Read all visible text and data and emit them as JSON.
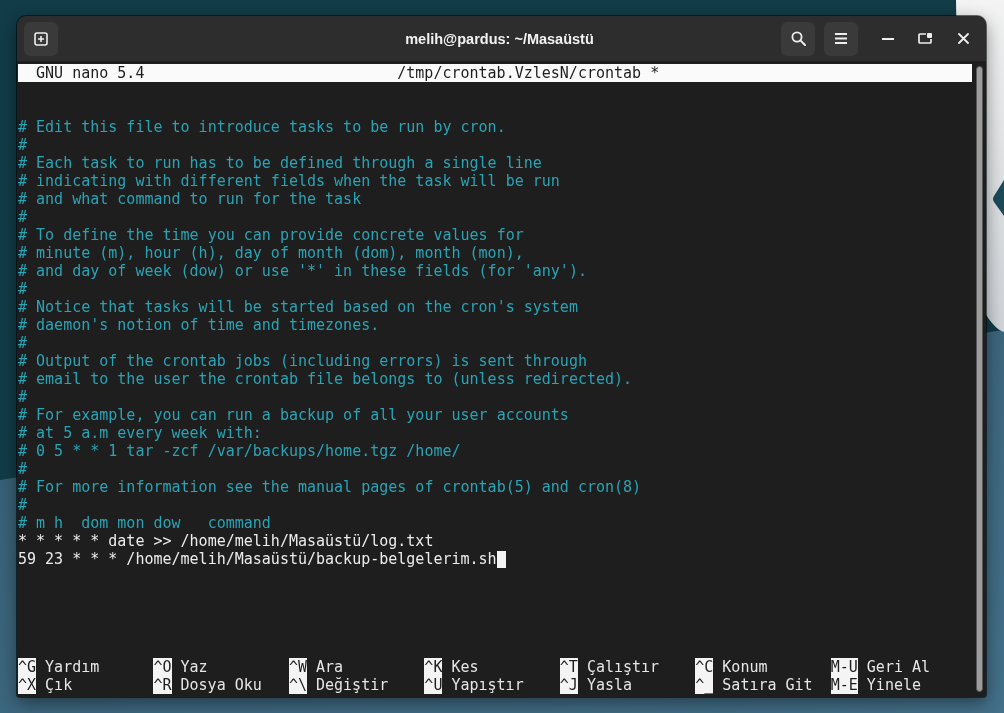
{
  "window": {
    "title": "melih@pardus: ~/Masaüstü"
  },
  "editor": {
    "version": "GNU nano 5.4",
    "file": "/tmp/crontab.VzlesN/crontab *",
    "lines": [
      {
        "kind": "comment",
        "text": "# Edit this file to introduce tasks to be run by cron.",
        "cursor": false
      },
      {
        "kind": "comment",
        "text": "#",
        "cursor": false
      },
      {
        "kind": "comment",
        "text": "# Each task to run has to be defined through a single line",
        "cursor": false
      },
      {
        "kind": "comment",
        "text": "# indicating with different fields when the task will be run",
        "cursor": false
      },
      {
        "kind": "comment",
        "text": "# and what command to run for the task",
        "cursor": false
      },
      {
        "kind": "comment",
        "text": "#",
        "cursor": false
      },
      {
        "kind": "comment",
        "text": "# To define the time you can provide concrete values for",
        "cursor": false
      },
      {
        "kind": "comment",
        "text": "# minute (m), hour (h), day of month (dom), month (mon),",
        "cursor": false
      },
      {
        "kind": "comment",
        "text": "# and day of week (dow) or use '*' in these fields (for 'any').",
        "cursor": false
      },
      {
        "kind": "comment",
        "text": "#",
        "cursor": false
      },
      {
        "kind": "comment",
        "text": "# Notice that tasks will be started based on the cron's system",
        "cursor": false
      },
      {
        "kind": "comment",
        "text": "# daemon's notion of time and timezones.",
        "cursor": false
      },
      {
        "kind": "comment",
        "text": "#",
        "cursor": false
      },
      {
        "kind": "comment",
        "text": "# Output of the crontab jobs (including errors) is sent through",
        "cursor": false
      },
      {
        "kind": "comment",
        "text": "# email to the user the crontab file belongs to (unless redirected).",
        "cursor": false
      },
      {
        "kind": "comment",
        "text": "#",
        "cursor": false
      },
      {
        "kind": "comment",
        "text": "# For example, you can run a backup of all your user accounts",
        "cursor": false
      },
      {
        "kind": "comment",
        "text": "# at 5 a.m every week with:",
        "cursor": false
      },
      {
        "kind": "comment",
        "text": "# 0 5 * * 1 tar -zcf /var/backups/home.tgz /home/",
        "cursor": false
      },
      {
        "kind": "comment",
        "text": "#",
        "cursor": false
      },
      {
        "kind": "comment",
        "text": "# For more information see the manual pages of crontab(5) and cron(8)",
        "cursor": false
      },
      {
        "kind": "comment",
        "text": "#",
        "cursor": false
      },
      {
        "kind": "comment",
        "text": "# m h  dom mon dow   command",
        "cursor": false
      },
      {
        "kind": "entry",
        "text": "* * * * * date >> /home/melih/Masaüstü/log.txt",
        "cursor": false
      },
      {
        "kind": "entry",
        "text": "59 23 * * * /home/melih/Masaüstü/backup-belgelerim.sh",
        "cursor": true
      }
    ],
    "shortcut_rows": [
      {
        "items": [
          {
            "key": "^G",
            "label": "Yardım"
          },
          {
            "key": "^O",
            "label": "Yaz"
          },
          {
            "key": "^W",
            "label": "Ara"
          },
          {
            "key": "^K",
            "label": "Kes"
          },
          {
            "key": "^T",
            "label": "Çalıştır"
          },
          {
            "key": "^C",
            "label": "Konum"
          },
          {
            "key": "M-U",
            "label": "Geri Al"
          }
        ]
      },
      {
        "items": [
          {
            "key": "^X",
            "label": "Çık"
          },
          {
            "key": "^R",
            "label": "Dosya Oku"
          },
          {
            "key": "^\\",
            "label": "Değiştir"
          },
          {
            "key": "^U",
            "label": "Yapıştır"
          },
          {
            "key": "^J",
            "label": "Yasla"
          },
          {
            "key": "^_",
            "label": "Satıra Git"
          },
          {
            "key": "M-E",
            "label": "Yinele"
          }
        ]
      }
    ]
  }
}
